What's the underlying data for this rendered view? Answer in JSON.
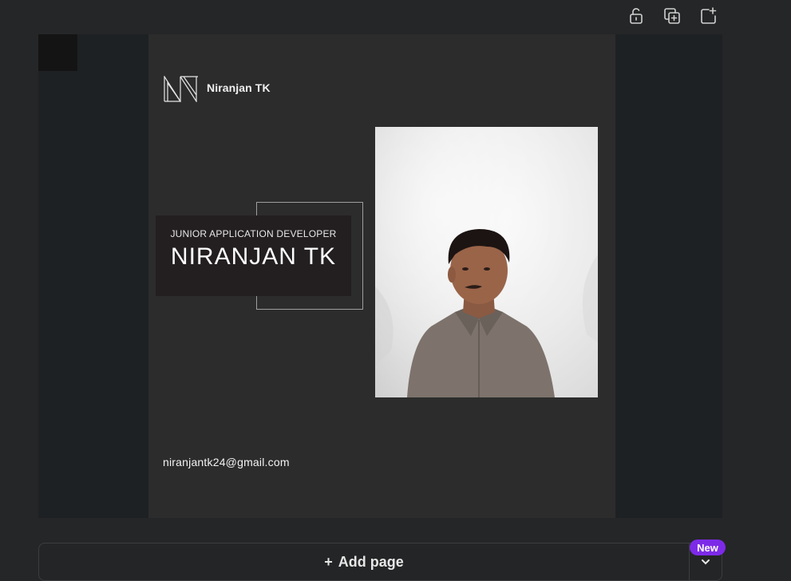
{
  "toolbar": {
    "icons": [
      "unlock-icon",
      "duplicate-page-icon",
      "add-page-icon"
    ]
  },
  "design": {
    "brand_name": "Niranjan TK",
    "role": "JUNIOR APPLICATION DEVELOPER",
    "name": "NIRANJAN TK",
    "email": "niranjantk24@gmail.com"
  },
  "footer": {
    "add_page_label": "Add page",
    "add_page_icon": "+",
    "badge": "New"
  },
  "colors": {
    "page_background": "#2c2c2c",
    "canvas_background": "#1e2124",
    "badge": "#7d2ae8"
  }
}
